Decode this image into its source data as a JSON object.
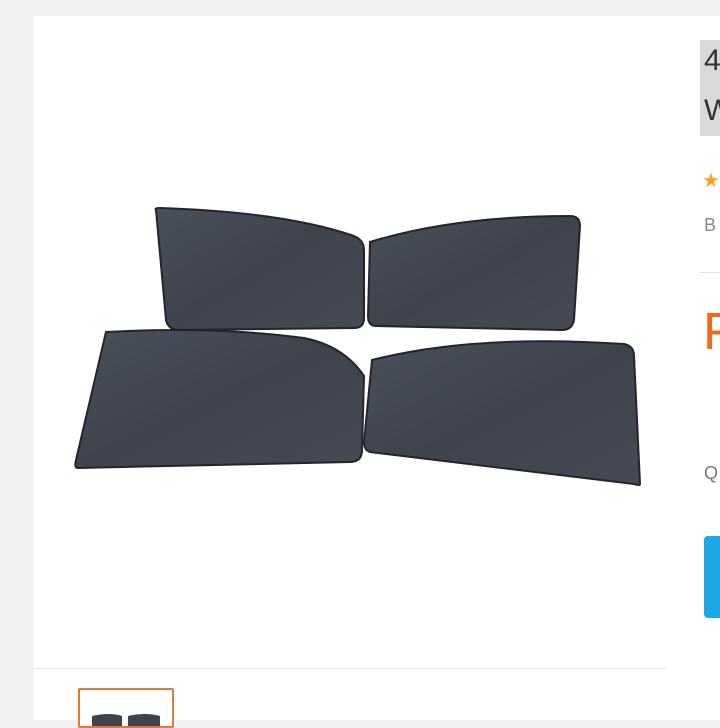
{
  "product": {
    "title_line1": "4",
    "title_line2": "W",
    "rating_star": "★",
    "meta_text": "B",
    "price_text": "F",
    "quantity_label": "Q"
  },
  "gallery": {
    "main_image_icon": "sun-shade-panels-image",
    "thumbnail_icon": "sun-shade-thumbnail"
  },
  "colors": {
    "accent_orange": "#f06a1b",
    "thumb_border": "#e0793f",
    "cta_blue": "#1ea7e4",
    "star_yellow": "#f5a623"
  }
}
